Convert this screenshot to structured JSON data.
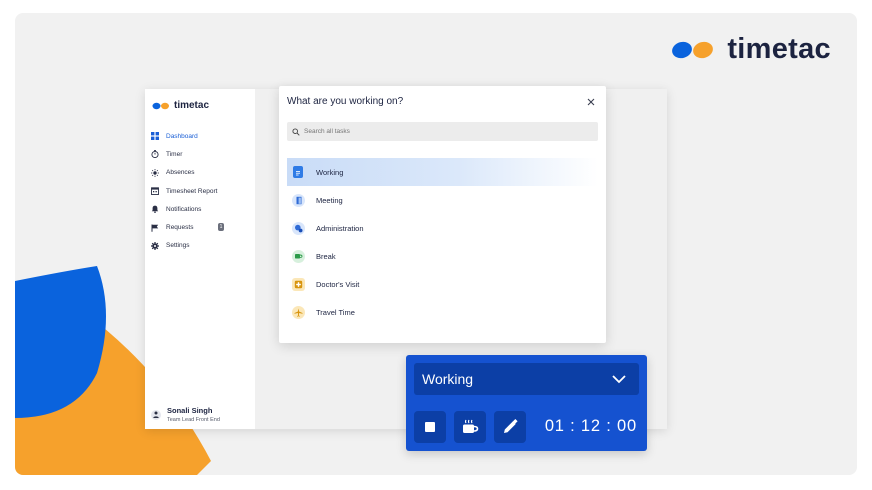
{
  "brand": {
    "name": "timetac"
  },
  "colors": {
    "brand_blue": "#0a63dd",
    "brand_orange": "#f6a12c",
    "accent_blue": "#1552d0",
    "dark_blue": "#0c3fa6"
  },
  "sidebar": {
    "logo": "timetac",
    "items": [
      {
        "label": "Dashboard",
        "icon": "dashboard-icon",
        "active": true
      },
      {
        "label": "Timer",
        "icon": "stopwatch-icon"
      },
      {
        "label": "Absences",
        "icon": "sun-icon"
      },
      {
        "label": "Timesheet Report",
        "icon": "calendar-icon"
      },
      {
        "label": "Notifications",
        "icon": "bell-icon"
      },
      {
        "label": "Requests",
        "icon": "flag-icon",
        "badge": "1"
      },
      {
        "label": "Settings",
        "icon": "gear-icon"
      }
    ],
    "user": {
      "name": "Sonali Singh",
      "role": "Team Lead Front End"
    }
  },
  "modal": {
    "title": "What are you working on?",
    "search_placeholder": "Search all tasks",
    "tasks": [
      {
        "label": "Working",
        "icon": "clipboard-icon",
        "active": true
      },
      {
        "label": "Meeting",
        "icon": "door-icon"
      },
      {
        "label": "Administration",
        "icon": "admin-icon"
      },
      {
        "label": "Break",
        "icon": "coffee-icon"
      },
      {
        "label": "Doctor's Visit",
        "icon": "medical-icon"
      },
      {
        "label": "Travel Time",
        "icon": "airplane-icon"
      }
    ]
  },
  "timer": {
    "selected_task": "Working",
    "elapsed": "01 : 12 : 00",
    "buttons": [
      "stop-icon",
      "coffee-icon",
      "pencil-icon"
    ]
  }
}
